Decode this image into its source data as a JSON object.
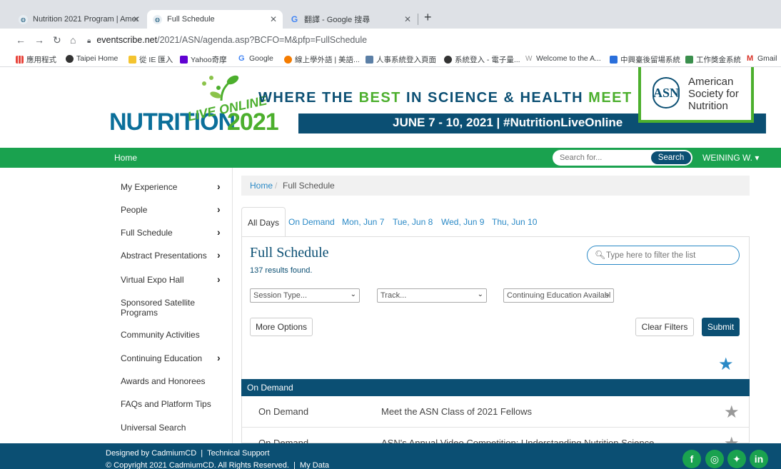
{
  "browser": {
    "tabs": [
      {
        "title": "Nutrition 2021 Program | Amer",
        "active": false
      },
      {
        "title": "Full Schedule",
        "active": true
      },
      {
        "title": "翻譯 - Google 搜尋",
        "active": false
      }
    ],
    "url_host": "eventscribe.net",
    "url_path": "/2021/ASN/agenda.asp?BCFO=M&pfp=FullSchedule",
    "bookmarks": [
      "應用程式",
      "Taipei Home",
      "從 IE 匯入",
      "Yahoo奇摩",
      "Google",
      "線上學外語 | 美語...",
      "人事系統登入頁面",
      "系統登入 - 電子量...",
      "Welcome to the A...",
      "中興臺後留場系統",
      "工作獎金系統",
      "Gmail"
    ]
  },
  "header": {
    "logo_main": "NUTRITION",
    "logo_live": "LIVE ONLINE",
    "logo_year": "2021",
    "tagline_1": "WHERE THE ",
    "tagline_best": "BEST",
    "tagline_2": " IN SCIENCE & HEALTH ",
    "tagline_meet": "MEET",
    "dates": "JUNE 7 - 10, 2021 | #NutritionLiveOnline",
    "asn_abbr": "ASN",
    "asn_name_1": "American",
    "asn_name_2": "Society for",
    "asn_name_3": "Nutrition"
  },
  "nav": {
    "home": "Home",
    "search_placeholder": "Search for...",
    "search_button": "Search",
    "user": "WEINING W. ▾"
  },
  "sidebar": {
    "items": [
      {
        "label": "My Experience",
        "chevron": true
      },
      {
        "label": "People",
        "chevron": true
      },
      {
        "label": "Full Schedule",
        "chevron": true
      },
      {
        "label": "Abstract Presentations",
        "chevron": true
      },
      {
        "label": "Virtual Expo Hall",
        "chevron": true
      },
      {
        "label": "Sponsored Satellite Programs",
        "chevron": false
      },
      {
        "label": "Community Activities",
        "chevron": false
      },
      {
        "label": "Continuing Education",
        "chevron": true
      },
      {
        "label": "Awards and Honorees",
        "chevron": false
      },
      {
        "label": "FAQs and Platform Tips",
        "chevron": false
      },
      {
        "label": "Universal Search",
        "chevron": false
      }
    ],
    "chevron": "›"
  },
  "breadcrumb": {
    "home": "Home",
    "separator": "/",
    "current": "Full Schedule"
  },
  "day_tabs": [
    "All Days",
    "On Demand",
    "Mon, Jun 7",
    "Tue, Jun 8",
    "Wed, Jun 9",
    "Thu, Jun 10"
  ],
  "schedule": {
    "title": "Full Schedule",
    "count": "137 results found.",
    "filter_placeholder": "Type here to filter the list",
    "session_type": "Session Type...",
    "track": "Track...",
    "continuing_ed": "Continuing Education Availabl",
    "more_options": "More Options",
    "clear_filters": "Clear Filters",
    "submit": "Submit",
    "group_header": "On Demand",
    "rows": [
      {
        "time": "On Demand",
        "title": "Meet the ASN Class of 2021 Fellows"
      },
      {
        "time": "On Demand",
        "title": "ASN's Annual Video Competition: Understanding Nutrition Science"
      }
    ]
  },
  "footer": {
    "designed_by": "Designed by CadmiumCD",
    "sep": "|",
    "tech_support": "Technical Support",
    "copyright": "© Copyright 2021 CadmiumCD. All Rights Reserved.",
    "my_data": "My Data"
  },
  "colors": {
    "green": "#1aa24f",
    "navy": "#0b4f73",
    "link": "#2a89c6"
  }
}
